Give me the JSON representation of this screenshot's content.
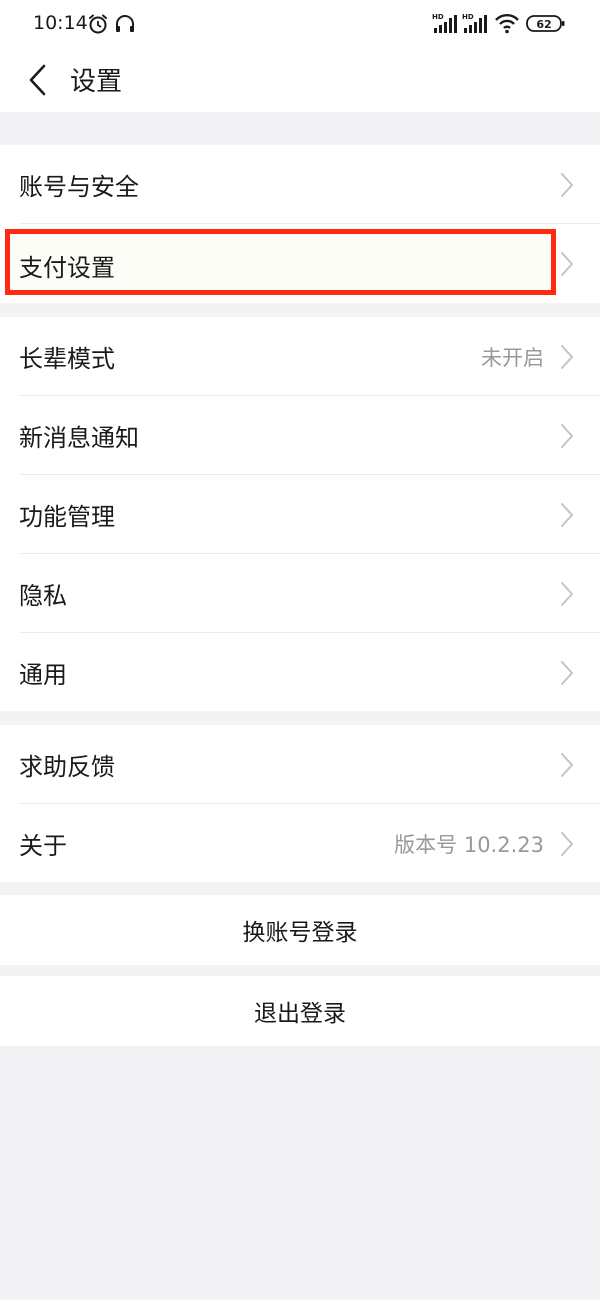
{
  "status_bar": {
    "time": "10:14",
    "battery": "62",
    "icons": [
      "alarm-icon",
      "headset-icon",
      "hd-signal-icon",
      "hd-signal-icon",
      "wifi-icon",
      "battery-icon"
    ]
  },
  "nav": {
    "title": "设置",
    "back_icon": "chevron-left-icon"
  },
  "groups": [
    {
      "items": [
        {
          "label": "账号与安全",
          "value": ""
        },
        {
          "label": "支付设置",
          "value": ""
        }
      ]
    },
    {
      "items": [
        {
          "label": "长辈模式",
          "value": "未开启"
        },
        {
          "label": "新消息通知",
          "value": ""
        },
        {
          "label": "功能管理",
          "value": ""
        },
        {
          "label": "隐私",
          "value": ""
        },
        {
          "label": "通用",
          "value": ""
        }
      ]
    },
    {
      "items": [
        {
          "label": "求助反馈",
          "value": ""
        },
        {
          "label": "关于",
          "value": "版本号 10.2.23"
        }
      ]
    }
  ],
  "actions": {
    "switch_account": "换账号登录",
    "logout": "退出登录"
  },
  "colors": {
    "background": "#f3f3f5",
    "card": "#ffffff",
    "highlight": "#ff2a12",
    "secondary_text": "#999999"
  }
}
